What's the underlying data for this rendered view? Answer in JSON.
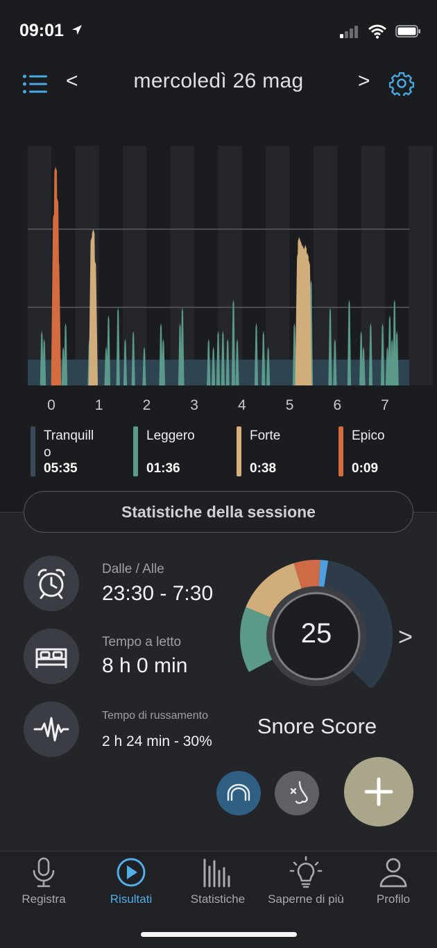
{
  "status_bar": {
    "time": "09:01"
  },
  "header": {
    "prev": "<",
    "next": ">",
    "date": "mercoledì 26 mag"
  },
  "chart_data": {
    "type": "area",
    "x_ticks": [
      "0",
      "1",
      "2",
      "3",
      "4",
      "5",
      "6",
      "7"
    ],
    "xlim": [
      0,
      7.4
    ],
    "ylim": [
      0,
      2.8
    ],
    "gridlines": [
      1,
      2
    ],
    "series": [
      {
        "name": "Tranquillo",
        "color": "#2e4451",
        "level": 0.33
      },
      {
        "name": "Leggero",
        "color": "#5b9a8a",
        "spikes": [
          [
            -0.2,
            0.7
          ],
          [
            -0.15,
            0.6
          ],
          [
            0.25,
            0.5
          ],
          [
            0.3,
            0.8
          ],
          [
            0.8,
            0.6
          ],
          [
            1.15,
            0.5
          ],
          [
            1.2,
            0.9
          ],
          [
            1.4,
            1.0
          ],
          [
            1.55,
            0.6
          ],
          [
            1.72,
            0.7
          ],
          [
            1.95,
            0.5
          ],
          [
            2.3,
            0.8
          ],
          [
            2.35,
            0.6
          ],
          [
            2.7,
            0.8
          ],
          [
            2.75,
            1.0
          ],
          [
            3.3,
            0.6
          ],
          [
            3.4,
            0.5
          ],
          [
            3.5,
            0.7
          ],
          [
            3.6,
            0.7
          ],
          [
            3.7,
            0.6
          ],
          [
            3.82,
            1.1
          ],
          [
            3.9,
            0.6
          ],
          [
            4.3,
            0.8
          ],
          [
            4.45,
            0.7
          ],
          [
            4.55,
            0.5
          ],
          [
            5.1,
            0.8
          ],
          [
            5.45,
            1.35
          ],
          [
            5.85,
            1.0
          ],
          [
            5.95,
            0.6
          ],
          [
            6.25,
            1.1
          ],
          [
            6.5,
            0.7
          ],
          [
            6.55,
            0.5
          ],
          [
            6.7,
            0.8
          ],
          [
            6.95,
            0.8
          ],
          [
            7.05,
            0.5
          ],
          [
            7.1,
            0.9
          ],
          [
            7.15,
            0.6
          ],
          [
            7.2,
            1.1
          ],
          [
            7.25,
            0.7
          ]
        ]
      },
      {
        "name": "Forte",
        "color": "#d0ad7b",
        "spikes": [
          [
            0.85,
            1.9
          ],
          [
            0.88,
            2.0
          ],
          [
            0.91,
            1.6
          ],
          [
            5.18,
            1.7
          ],
          [
            5.2,
            1.9
          ],
          [
            5.23,
            1.85
          ],
          [
            5.27,
            1.8
          ],
          [
            5.3,
            1.75
          ],
          [
            5.33,
            1.8
          ],
          [
            5.37,
            1.7
          ],
          [
            5.4,
            1.6
          ]
        ]
      },
      {
        "name": "Epico",
        "color": "#d46c40",
        "spikes": [
          [
            0.06,
            2.2
          ],
          [
            0.09,
            2.8
          ],
          [
            0.12,
            2.4
          ],
          [
            0.14,
            1.6
          ]
        ]
      }
    ]
  },
  "legend": [
    {
      "name": "Tranquillo",
      "value": "05:35",
      "color": "#3b4b5a"
    },
    {
      "name": "Leggero",
      "value": "01:36",
      "color": "#5b9a8a"
    },
    {
      "name": "Forte",
      "value": "0:38",
      "color": "#d7b07c"
    },
    {
      "name": "Epico",
      "value": "0:09",
      "color": "#d46c40"
    }
  ],
  "session_button": "Statistiche della sessione",
  "stats": {
    "time_range": {
      "label": "Dalle / Alle",
      "value": "23:30 - 7:30"
    },
    "bed_time": {
      "label": "Tempo a letto",
      "value": "8 h 0 min"
    },
    "snore_time": {
      "label": "Tempo di russamento",
      "value": "2 h 24 min - 30%"
    }
  },
  "score": {
    "value": "25",
    "title": "Snore Score",
    "more": ">"
  },
  "score_gauge": [
    {
      "name": "Leggero",
      "color": "#5b9a8a",
      "fraction": 0.1
    },
    {
      "name": "Forte",
      "color": "#d0ad7b",
      "fraction": 0.1
    },
    {
      "name": "Epico",
      "color": "#cf6a46",
      "fraction": 0.04
    },
    {
      "name": "marker",
      "color": "#4d9fe0",
      "fraction": 0.012
    },
    {
      "name": "Tranquillo",
      "color": "#2e3c49",
      "fraction": 0.248
    }
  ],
  "tabs": [
    {
      "label": "Registra",
      "icon": "microphone-icon"
    },
    {
      "label": "Risultati",
      "icon": "play-icon"
    },
    {
      "label": "Statistiche",
      "icon": "bar-chart-icon"
    },
    {
      "label": "Saperne di più",
      "icon": "lightbulb-icon"
    },
    {
      "label": "Profilo",
      "icon": "person-icon"
    }
  ],
  "colors": {
    "accent": "#52aee6",
    "background": "#1b1c20",
    "fab": "#a9a689"
  }
}
